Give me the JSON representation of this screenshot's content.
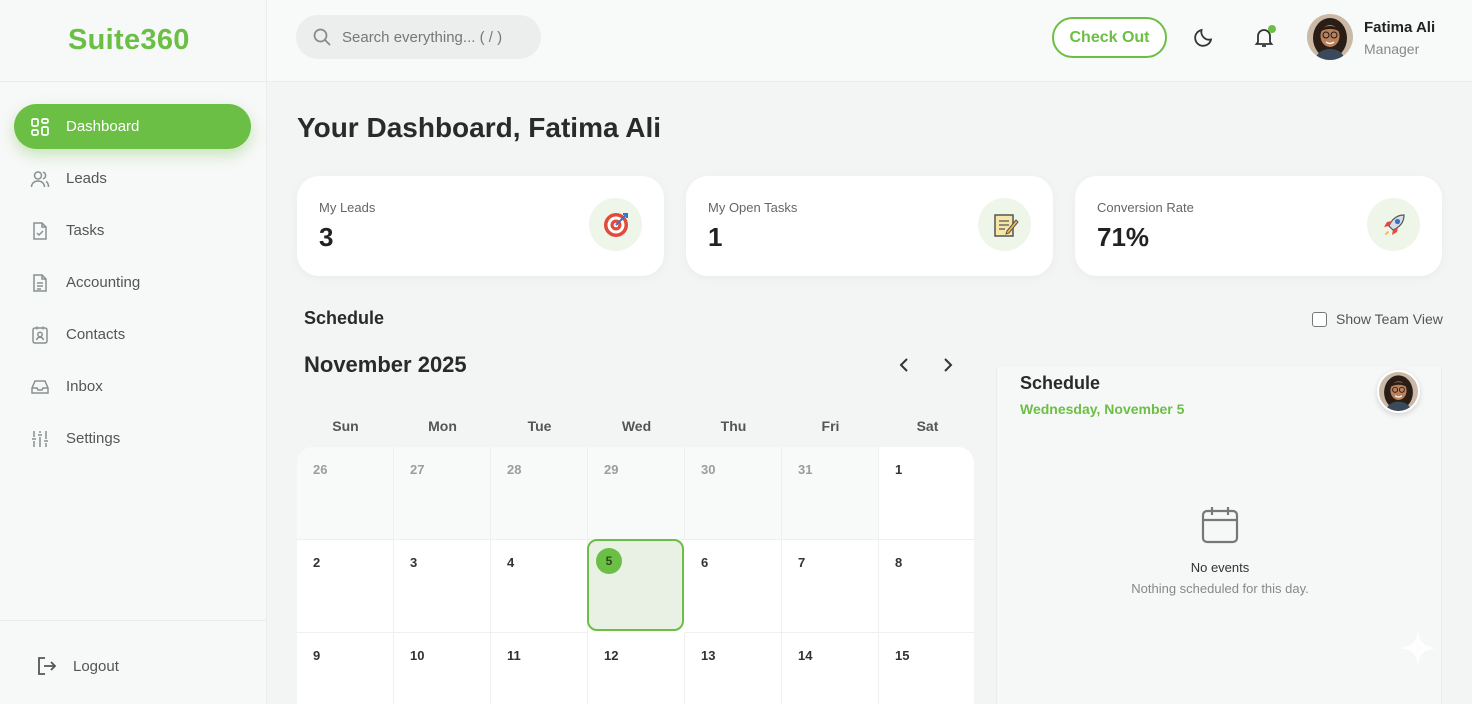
{
  "brand": {
    "name": "Suite360",
    "color": "#6cbf45"
  },
  "sidebar": {
    "items": [
      {
        "label": "Dashboard",
        "icon": "dashboard-icon",
        "active": true
      },
      {
        "label": "Leads",
        "icon": "users-icon"
      },
      {
        "label": "Tasks",
        "icon": "task-icon"
      },
      {
        "label": "Accounting",
        "icon": "document-icon"
      },
      {
        "label": "Contacts",
        "icon": "contact-card-icon"
      },
      {
        "label": "Inbox",
        "icon": "inbox-icon"
      },
      {
        "label": "Settings",
        "icon": "sliders-icon"
      }
    ],
    "logout_label": "Logout"
  },
  "header": {
    "search_placeholder": "Search everything... ( / )",
    "checkout_label": "Check Out",
    "user": {
      "name": "Fatima Ali",
      "role": "Manager"
    }
  },
  "page": {
    "title": "Your Dashboard, Fatima Ali"
  },
  "stats": [
    {
      "label": "My Leads",
      "value": "3",
      "icon": "target-icon"
    },
    {
      "label": "My Open Tasks",
      "value": "1",
      "icon": "notepad-icon"
    },
    {
      "label": "Conversion Rate",
      "value": "71%",
      "icon": "rocket-icon"
    }
  ],
  "schedule": {
    "heading": "Schedule",
    "team_view_label": "Show Team View",
    "team_view_checked": false,
    "month": "November 2025",
    "weekdays": [
      "Sun",
      "Mon",
      "Tue",
      "Wed",
      "Thu",
      "Fri",
      "Sat"
    ],
    "weeks": [
      [
        {
          "d": "26",
          "other": true
        },
        {
          "d": "27",
          "other": true
        },
        {
          "d": "28",
          "other": true
        },
        {
          "d": "29",
          "other": true
        },
        {
          "d": "30",
          "other": true
        },
        {
          "d": "31",
          "other": true
        },
        {
          "d": "1"
        }
      ],
      [
        {
          "d": "2"
        },
        {
          "d": "3"
        },
        {
          "d": "4"
        },
        {
          "d": "5",
          "today": true
        },
        {
          "d": "6"
        },
        {
          "d": "7"
        },
        {
          "d": "8"
        }
      ],
      [
        {
          "d": "9"
        },
        {
          "d": "10"
        },
        {
          "d": "11"
        },
        {
          "d": "12"
        },
        {
          "d": "13"
        },
        {
          "d": "14"
        },
        {
          "d": "15"
        }
      ]
    ]
  },
  "day_panel": {
    "title": "Schedule",
    "date": "Wednesday, November 5",
    "empty_title": "No events",
    "empty_subtitle": "Nothing scheduled for this day."
  }
}
